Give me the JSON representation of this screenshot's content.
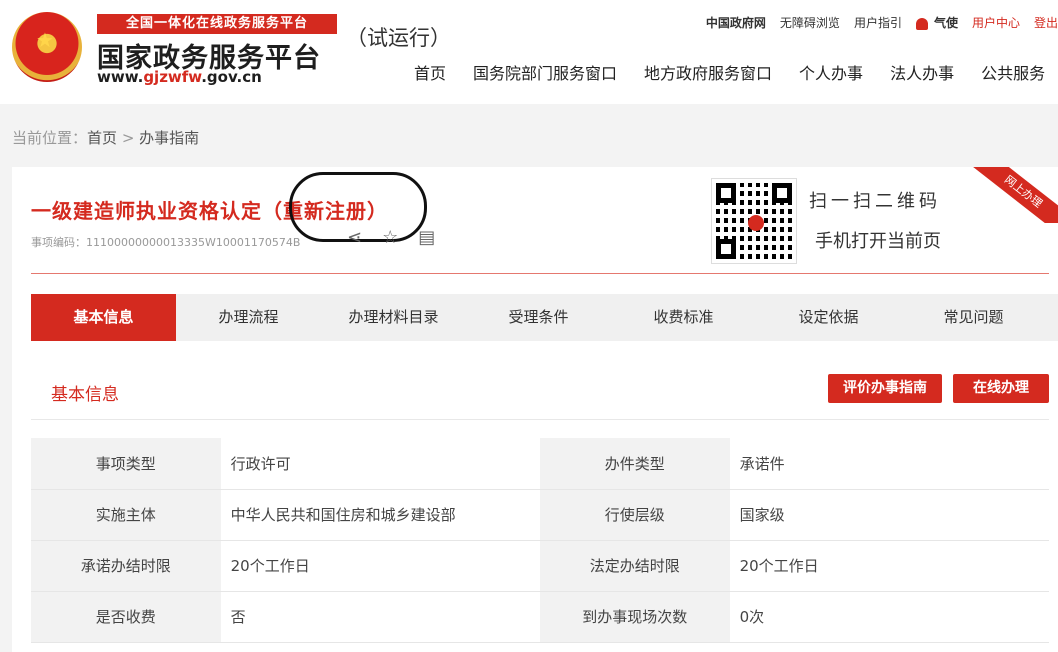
{
  "header": {
    "banner": "全国一体化在线政务服务平台",
    "title": "国家政务服务平台",
    "url_prefix": "www.",
    "url_highlight": "gjzwfw",
    "url_suffix": ".gov.cn",
    "trial": "（试运行）",
    "top_links": [
      "中国政府网",
      "无障碍浏览",
      "用户指引",
      "气使",
      "用户中心",
      "登出"
    ],
    "nav": [
      "首页",
      "国务院部门服务窗口",
      "地方政府服务窗口",
      "个人办事",
      "法人办事",
      "公共服务"
    ]
  },
  "breadcrumb": {
    "prefix": "当前位置：",
    "home": "首页",
    "sep": ">",
    "current": "办事指南"
  },
  "item": {
    "title": "一级建造师执业资格认定（重新注册）",
    "code": "事项编码：11100000000013335W10001170574B",
    "qr_line1": "扫一扫二维码",
    "qr_line2": "手机打开当前页",
    "ribbon": "网上办理"
  },
  "tabs": [
    "基本信息",
    "办理流程",
    "办理材料目录",
    "受理条件",
    "收费标准",
    "设定依据",
    "常见问题"
  ],
  "section": {
    "title": "基本信息",
    "eval_button": "评价办事指南",
    "online_button": "在线办理"
  },
  "table": [
    {
      "l1": "事项类型",
      "v1": "行政许可",
      "l2": "办件类型",
      "v2": "承诺件"
    },
    {
      "l1": "实施主体",
      "v1": "中华人民共和国住房和城乡建设部",
      "l2": "行使层级",
      "v2": "国家级"
    },
    {
      "l1": "承诺办结时限",
      "v1": "20个工作日",
      "l2": "法定办结时限",
      "v2": "20个工作日"
    },
    {
      "l1": "是否收费",
      "v1": "否",
      "l2": "到办事现场次数",
      "v2": "0次"
    }
  ],
  "icons": {
    "share": "share-icon",
    "favorite": "star-icon",
    "print": "document-icon",
    "user": "user-icon"
  },
  "colors": {
    "accent": "#d42a1f"
  }
}
